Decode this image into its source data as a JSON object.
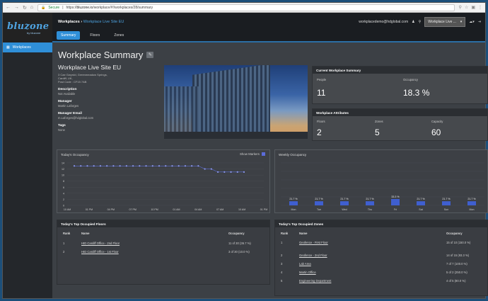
{
  "browser": {
    "secure_label": "Secure",
    "url_prefix": "https://",
    "url_host": "bluzone.io",
    "url_path": "/workplace/#!/workplaces/28/summary"
  },
  "logo": {
    "brand": "bluzone",
    "sub": "by bluzone"
  },
  "header": {
    "crumb_root": "Workplaces",
    "crumb_sep": "›",
    "crumb_current": "Workplace Live Site EU",
    "email": "workplacedemo@hdglobal.com",
    "workplace_select": "Workplace Live ...",
    "tabs": [
      {
        "label": "Summary",
        "active": true
      },
      {
        "label": "Floors",
        "active": false
      },
      {
        "label": "Zones",
        "active": false
      }
    ]
  },
  "sidebar": {
    "items": [
      {
        "label": "Workplaces"
      }
    ]
  },
  "page": {
    "title": "Workplace Summary",
    "site_name": "Workplace Live Site EU",
    "address_lines": [
      "3 Cae Gwyrdd, Greenmeadow Springs,",
      "Cardiff, UK,",
      "Post Code : CF15 7AB"
    ],
    "description_label": "Description",
    "description": "Not Available",
    "manager_label": "Manager",
    "manager": "Martin Laforges",
    "manager_email_label": "Manager Email",
    "manager_email": "m.Laforges@hdglobal.com",
    "tags_label": "Tags",
    "tags": "None"
  },
  "current_summary": {
    "title": "Current Workplace Summary",
    "people_label": "People",
    "people": "11",
    "occupancy_label": "Occupancy",
    "occupancy": "18.3 %"
  },
  "attributes": {
    "title": "Workplace Attributes",
    "floors_label": "Floors",
    "floors": "2",
    "zones_label": "Zones",
    "zones": "5",
    "capacity_label": "Capacity",
    "capacity": "60"
  },
  "chart_data": [
    {
      "type": "line",
      "title": "Today's Occupancy",
      "toggle_label": "Show Markers",
      "x": [
        "10 AM",
        "",
        "",
        "",
        "",
        "",
        "",
        "",
        "",
        "",
        "",
        "",
        "",
        "",
        "",
        "",
        "",
        "",
        "",
        "",
        "",
        "",
        "",
        "",
        "",
        ""
      ],
      "x_ticks": [
        "10 AM",
        "01 PM",
        "04 PM",
        "07 PM",
        "10 PM",
        "01 AM",
        "04 AM",
        "07 AM",
        "10 AM",
        "01 PM"
      ],
      "y_ticks": [
        "0",
        "2",
        "4",
        "6",
        "8",
        "10",
        "12",
        "14"
      ],
      "ylim": [
        0,
        14
      ],
      "values": [
        13,
        13,
        13,
        13,
        13,
        13,
        13,
        13,
        13,
        13,
        13,
        13,
        13,
        13,
        13,
        13,
        13,
        13,
        13,
        13,
        12,
        12,
        11,
        11,
        11,
        11,
        11
      ]
    },
    {
      "type": "bar",
      "title": "Weekly Occupancy",
      "categories": [
        "Mon",
        "Tue",
        "Wed",
        "Thu",
        "Fri",
        "Sat",
        "Sun",
        "Mon"
      ],
      "values": [
        21.7,
        21.7,
        21.7,
        21.7,
        33.3,
        21.7,
        21.7,
        21.7
      ],
      "labels": [
        "21.7 %",
        "21.7 %",
        "21.7 %",
        "21.7 %",
        "33.3 %",
        "21.7 %",
        "21.7 %",
        "21.7 %"
      ],
      "ylim": [
        0,
        100
      ]
    }
  ],
  "floors_table": {
    "title": "Today's Top Occupied Floors",
    "headers": [
      "Rank",
      "Name",
      "Occupancy"
    ],
    "rows": [
      {
        "rank": "1",
        "name": "HID Cardiff Office - 2nd Floor",
        "occupancy": "11 of 30 (36.7 %)"
      },
      {
        "rank": "2",
        "name": "HID Cardiff Office - 1st Floor",
        "occupancy": "3 of 30 (10.0 %)"
      }
    ]
  },
  "zones_table": {
    "title": "Today's Top Occupied Zones",
    "headers": [
      "Rank",
      "Name",
      "Occupancy"
    ],
    "rows": [
      {
        "rank": "1",
        "name": "Geofence - First Floor",
        "occupancy": "15 of 10 (150.0 %)"
      },
      {
        "rank": "2",
        "name": "Geofence - 2nd Floor",
        "occupancy": "14 of 15 (93.3 %)"
      },
      {
        "rank": "3",
        "name": "Lab Area",
        "occupancy": "7 of 7 (100.0 %)"
      },
      {
        "rank": "4",
        "name": "Martin Office",
        "occupancy": "5 of 2 (250.0 %)"
      },
      {
        "rank": "5",
        "name": "Engineering Department",
        "occupancy": "4 of 5 (80.0 %)"
      }
    ]
  }
}
